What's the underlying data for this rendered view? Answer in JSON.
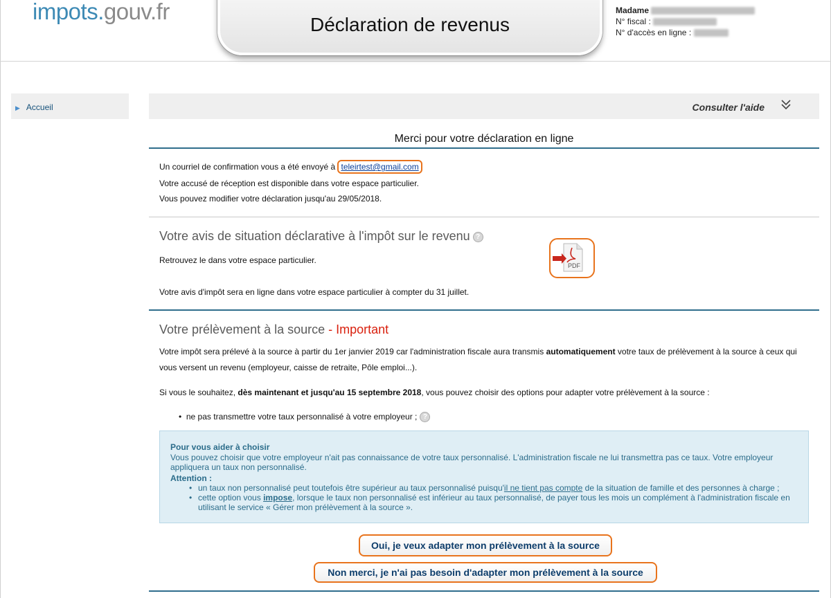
{
  "header": {
    "logo_part1": "impots.",
    "logo_part2": "gouv.fr",
    "title": "Déclaration de revenus",
    "user_label": "Madame",
    "fiscal_label": "N° fiscal :",
    "access_label": "N° d'accès en ligne :"
  },
  "sidebar": {
    "items": [
      {
        "label": "Accueil"
      }
    ]
  },
  "help_bar": {
    "label": "Consulter l'aide"
  },
  "confirmation": {
    "title": "Merci pour votre déclaration en ligne",
    "email_prefix": "Un courriel de confirmation vous a été envoyé à ",
    "email": "teleirtest@gmail.com",
    "line2": "Votre accusé de réception est disponible dans votre espace particulier.",
    "line3": "Vous pouvez modifier votre déclaration jusqu'au 29/05/2018."
  },
  "avis": {
    "title": "Votre avis de situation déclarative à l'impôt sur le revenu",
    "line1": "Retrouvez le dans votre espace particulier.",
    "line2": "Votre avis d'impôt sera en ligne dans votre espace particulier à compter du 31 juillet.",
    "pdf_label": "PDF"
  },
  "prelevement": {
    "title": "Votre prélèvement à la source",
    "title_suffix": " - Important",
    "p1_a": "Votre impôt sera prélevé à la source à partir du 1er janvier 2019 car l'administration fiscale aura transmis ",
    "p1_b": "automatiquement",
    "p1_c": " votre taux de prélèvement à la source à ceux qui",
    "p1_d": "vous versent un revenu (employeur, caisse de retraite, Pôle emploi...).",
    "p2_a": "Si vous le souhaitez, ",
    "p2_b": "dès maintenant et jusqu'au 15 septembre 2018",
    "p2_c": ", vous pouvez choisir des options pour adapter votre prélèvement à la source :",
    "bullet": "ne pas transmettre votre taux personnalisé à votre employeur ;"
  },
  "info_box": {
    "title": "Pour vous aider à choisir",
    "text": "Vous pouvez choisir que votre employeur n'ait pas connaissance de votre taux personnalisé. L'administration fiscale ne lui transmettra pas ce taux. Votre employeur appliquera un taux non personnalisé.",
    "attention": "Attention :",
    "li1_a": "un taux non personnalisé peut toutefois être supérieur au taux personnalisé puisqu'",
    "li1_b": "il ne tient pas compte",
    "li1_c": " de la situation de famille et des personnes à charge ;",
    "li2_a": "cette option vous ",
    "li2_b": "impose",
    "li2_c": ", lorsque le taux non personnalisé est inférieur au taux personnalisé, de payer tous les mois un complément à l'administration fiscale en utilisant le service « Gérer mon prélèvement à la source »."
  },
  "buttons": {
    "yes": "Oui, je veux adapter mon prélèvement à la source",
    "no": "Non merci, je n'ai pas besoin d'adapter mon prélèvement à la source"
  },
  "colors": {
    "accent_blue": "#2f6d8c",
    "highlight_orange": "#e8731c",
    "important_red": "#d9200e"
  }
}
